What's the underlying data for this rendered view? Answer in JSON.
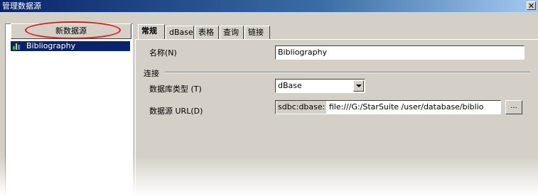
{
  "window": {
    "title": "管理数据源",
    "close_label": "✕"
  },
  "left": {
    "new_button": "新数据源",
    "datasources": [
      {
        "label": "Bibliography",
        "icon": "database-icon"
      }
    ]
  },
  "tabs": [
    {
      "label": "常规",
      "active": true
    },
    {
      "label": "dBase",
      "active": false
    },
    {
      "label": "表格",
      "active": false
    },
    {
      "label": "查询",
      "active": false
    },
    {
      "label": "链接",
      "active": false
    }
  ],
  "general": {
    "name_label": "名称(N)",
    "name_value": "Bibliography",
    "connection_heading": "连接",
    "db_type_label": "数据库类型 (T)",
    "db_type_value": "dBase",
    "url_label": "数据源 URL(D)",
    "url_prefix": "sdbc:dbase:",
    "url_value": "file:///G:/StarSuite /user/database/biblio",
    "browse_label": "..."
  },
  "colors": {
    "titlebar": "#0a246a",
    "highlight": "#0a246a",
    "annotation": "#e01818"
  }
}
